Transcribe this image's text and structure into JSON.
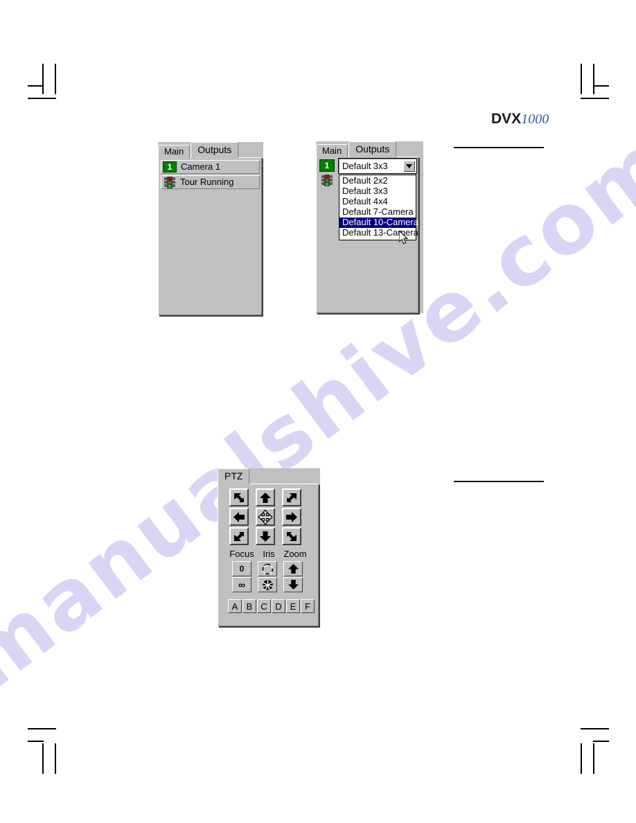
{
  "page": {
    "watermark_text": "manualshive.com",
    "watermark_color": "#d8d6f4"
  },
  "logo": {
    "brand": "DVX",
    "model": "1000",
    "brand_color": "#1a1a1a",
    "model_color": "#2f5aa8"
  },
  "rules": [
    {
      "name": "rule-top"
    },
    {
      "name": "rule-middle"
    }
  ],
  "panel_left": {
    "tabs": [
      {
        "label": "Main",
        "active": false
      },
      {
        "label": "Outputs",
        "active": true
      }
    ],
    "rows": [
      {
        "icon": "number-badge-icon",
        "badge": "1",
        "label": "Camera 1"
      },
      {
        "icon": "traffic-light-icon",
        "label": "Tour Running"
      }
    ]
  },
  "panel_right": {
    "tabs": [
      {
        "label": "Main",
        "active": false
      },
      {
        "label": "Outputs",
        "active": true
      }
    ],
    "badge": "1",
    "combo": {
      "value": "Default 3x3",
      "arrow_icon": "chevron-down-icon"
    },
    "dropdown_options": [
      {
        "label": "Default 2x2",
        "selected": false
      },
      {
        "label": "Default 3x3",
        "selected": false
      },
      {
        "label": "Default 4x4",
        "selected": false
      },
      {
        "label": "Default 7-Camera",
        "selected": false
      },
      {
        "label": "Default 10-Camera",
        "selected": true
      },
      {
        "label": "Default 13-Camera",
        "selected": false
      }
    ],
    "selection_color": "#000080",
    "cursor": "arrow-cursor"
  },
  "ptz": {
    "tab_label": "PTZ",
    "pad": [
      {
        "name": "pan-up-left-button",
        "icon": "arrow-up-left-icon"
      },
      {
        "name": "tilt-up-button",
        "icon": "arrow-up-icon"
      },
      {
        "name": "pan-up-right-button",
        "icon": "arrow-up-right-icon"
      },
      {
        "name": "pan-left-button",
        "icon": "arrow-left-icon"
      },
      {
        "name": "home-button",
        "icon": "four-way-move-icon"
      },
      {
        "name": "pan-right-button",
        "icon": "arrow-right-icon"
      },
      {
        "name": "pan-down-left-button",
        "icon": "arrow-down-left-icon"
      },
      {
        "name": "tilt-down-button",
        "icon": "arrow-down-icon"
      },
      {
        "name": "pan-down-right-button",
        "icon": "arrow-down-right-icon"
      }
    ],
    "group_labels": [
      "Focus",
      "Iris",
      "Zoom"
    ],
    "focus_near": "0",
    "focus_far": "∞",
    "iris_open_icon": "iris-open-icon",
    "iris_close_icon": "iris-closed-icon",
    "zoom_in_icon": "arrow-up-icon",
    "zoom_out_icon": "arrow-down-icon",
    "presets": [
      "A",
      "B",
      "C",
      "D",
      "E",
      "F"
    ]
  }
}
